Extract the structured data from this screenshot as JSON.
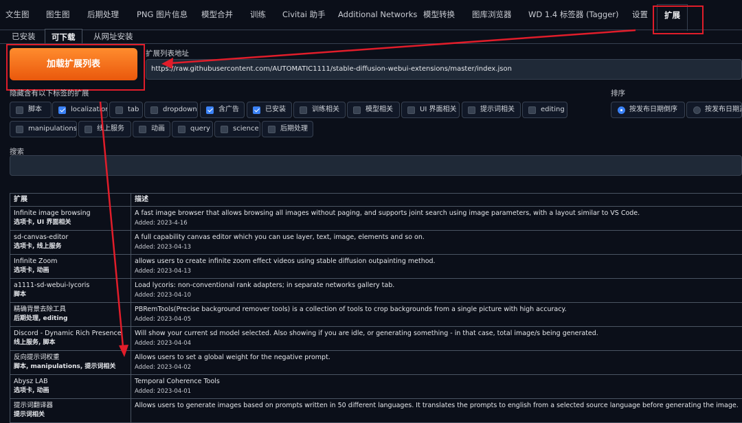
{
  "top_tabs": [
    {
      "label": "文生图",
      "active": false
    },
    {
      "label": "图生图",
      "active": false
    },
    {
      "label": "后期处理",
      "active": false
    },
    {
      "label": "PNG 图片信息",
      "active": false
    },
    {
      "label": "模型合并",
      "active": false
    },
    {
      "label": "训练",
      "active": false
    },
    {
      "label": "Civitai 助手",
      "active": false
    },
    {
      "label": "Additional Networks",
      "active": false
    },
    {
      "label": "模型转换",
      "active": false
    },
    {
      "label": "图库浏览器",
      "active": false
    },
    {
      "label": "WD 1.4 标签器 (Tagger)",
      "active": false
    },
    {
      "label": "设置",
      "active": false
    },
    {
      "label": "扩展",
      "active": true
    }
  ],
  "sub_tabs": [
    {
      "label": "已安装",
      "active": false
    },
    {
      "label": "可下载",
      "active": true
    },
    {
      "label": "从网址安装",
      "active": false
    }
  ],
  "load_button_label": "加载扩展列表",
  "url": {
    "label": "扩展列表地址",
    "value": "https://raw.githubusercontent.com/AUTOMATIC1111/stable-diffusion-webui-extensions/master/index.json"
  },
  "hide_label": "隐藏含有以下标签的扩展",
  "tags": [
    {
      "label": "脚本",
      "checked": false
    },
    {
      "label": "localization",
      "checked": true
    },
    {
      "label": "tab",
      "checked": false
    },
    {
      "label": "dropdown",
      "checked": false
    },
    {
      "label": "含广告",
      "checked": true
    },
    {
      "label": "已安装",
      "checked": true
    },
    {
      "label": "训练相关",
      "checked": false
    },
    {
      "label": "模型相关",
      "checked": false
    },
    {
      "label": "UI 界面相关",
      "checked": false
    },
    {
      "label": "提示词相关",
      "checked": false
    },
    {
      "label": "editing",
      "checked": false
    },
    {
      "label": "manipulations",
      "checked": false
    },
    {
      "label": "线上服务",
      "checked": false
    },
    {
      "label": "动画",
      "checked": false
    },
    {
      "label": "query",
      "checked": false
    },
    {
      "label": "science",
      "checked": false
    },
    {
      "label": "后期处理",
      "checked": false
    }
  ],
  "sort": {
    "label": "排序",
    "options": [
      {
        "label": "按发布日期倒序",
        "selected": true
      },
      {
        "label": "按发布日期正",
        "selected": false
      }
    ]
  },
  "search_label": "搜索",
  "table": {
    "headers": [
      "扩展",
      "描述"
    ],
    "rows": [
      {
        "name": "Infinite image browsing",
        "tags": "选项卡, UI 界面相关",
        "desc": "A fast image browser that allows browsing all images without paging, and supports joint search using image parameters, with a layout similar to VS Code.",
        "added": "Added: 2023-4-16"
      },
      {
        "name": "sd-canvas-editor",
        "tags": "选项卡, 线上服务",
        "desc": "A full capability canvas editor which you can use layer, text, image, elements and so on.",
        "added": "Added: 2023-04-13"
      },
      {
        "name": "Infinite Zoom",
        "tags": "选项卡, 动画",
        "desc": "allows users to create infinite zoom effect videos using stable diffusion outpainting method.",
        "added": "Added: 2023-04-13"
      },
      {
        "name": "a1111-sd-webui-lycoris",
        "tags": "脚本",
        "desc": "Load lycoris: non-conventional rank adapters; in separate networks gallery tab.",
        "added": "Added: 2023-04-10"
      },
      {
        "name": "精确背景去除工具",
        "tags": "后期处理, editing",
        "desc": "PBRemTools(Precise background remover tools) is a collection of tools to crop backgrounds from a single picture with high accuracy.",
        "added": "Added: 2023-04-05"
      },
      {
        "name": "Discord - Dynamic Rich Presence",
        "tags": "线上服务, 脚本",
        "desc": "Will show your current sd model selected. Also showing if you are idle, or generating something - in that case, total image/s being generated.",
        "added": "Added: 2023-04-04"
      },
      {
        "name": "反向提示词权重",
        "tags": "脚本, manipulations, 提示词相关",
        "desc": "Allows users to set a global weight for the negative prompt.",
        "added": "Added: 2023-04-02"
      },
      {
        "name": "Abysz LAB",
        "tags": "选项卡, 动画",
        "desc": "Temporal Coherence Tools",
        "added": "Added: 2023-04-01"
      },
      {
        "name": "提示词翻译器",
        "tags": "提示词相关",
        "desc": "Allows users to generate images based on prompts written in 50 different languages. It translates the prompts to english from a selected source language before generating the image.",
        "added": ""
      }
    ]
  },
  "colors": {
    "accent": "#ea580c",
    "annotation": "#e11d2a",
    "checkbox": "#3b82f6"
  }
}
